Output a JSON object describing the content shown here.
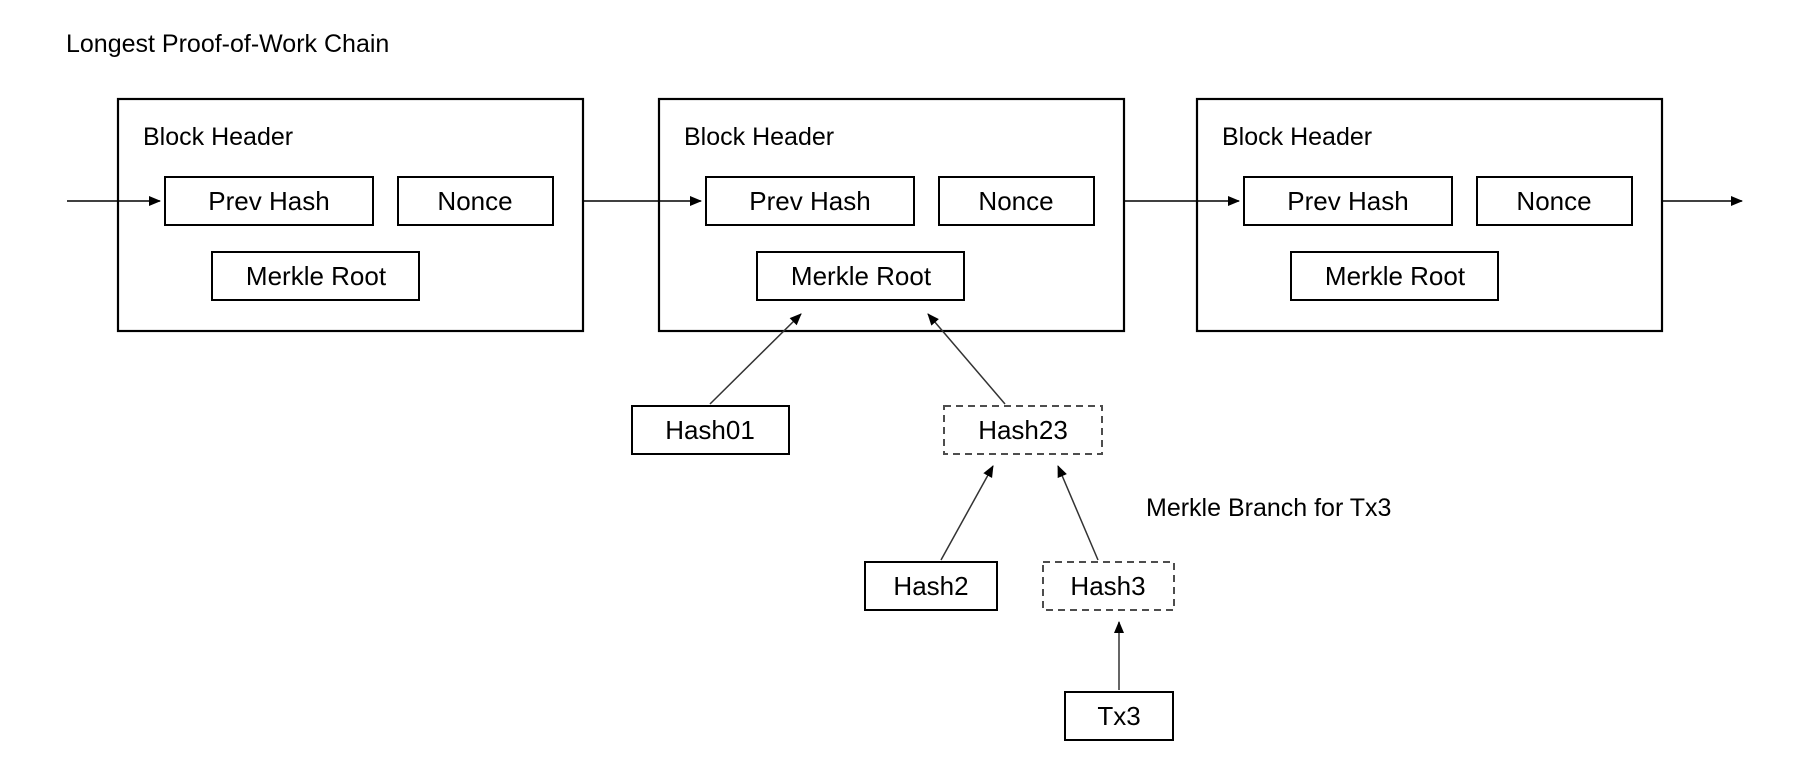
{
  "diagram": {
    "title": "Longest Proof-of-Work Chain",
    "annotation": "Merkle Branch for Tx3",
    "blocks": [
      {
        "header_label": "Block Header",
        "prev_hash_label": "Prev Hash",
        "nonce_label": "Nonce",
        "merkle_root_label": "Merkle Root"
      },
      {
        "header_label": "Block Header",
        "prev_hash_label": "Prev Hash",
        "nonce_label": "Nonce",
        "merkle_root_label": "Merkle Root"
      },
      {
        "header_label": "Block Header",
        "prev_hash_label": "Prev Hash",
        "nonce_label": "Nonce",
        "merkle_root_label": "Merkle Root"
      }
    ],
    "merkle_nodes": [
      {
        "id": "hash01",
        "label": "Hash01",
        "style": "solid"
      },
      {
        "id": "hash23",
        "label": "Hash23",
        "style": "dashed"
      },
      {
        "id": "hash2",
        "label": "Hash2",
        "style": "solid"
      },
      {
        "id": "hash3",
        "label": "Hash3",
        "style": "dashed"
      },
      {
        "id": "tx3",
        "label": "Tx3",
        "style": "solid"
      }
    ],
    "colors": {
      "stroke": "#000000",
      "dashed_stroke": "#4d4d4d",
      "background": "#ffffff",
      "text": "#000000"
    }
  }
}
